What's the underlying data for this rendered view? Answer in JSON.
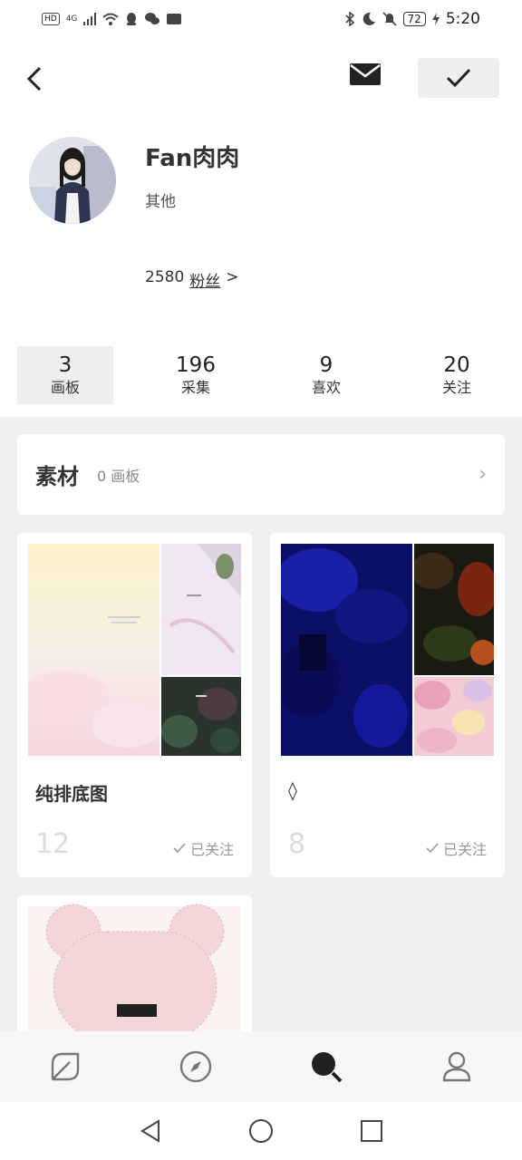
{
  "status_bar": {
    "left_badges": [
      "HD",
      "4G"
    ],
    "battery": "72",
    "time": "5:20"
  },
  "profile": {
    "username": "Fan肉肉",
    "subtitle": "其他",
    "followers_count": "2580",
    "followers_label": "粉丝",
    "followers_arrow": ">"
  },
  "stats": [
    {
      "num": "3",
      "label": "画板"
    },
    {
      "num": "196",
      "label": "采集"
    },
    {
      "num": "9",
      "label": "喜欢"
    },
    {
      "num": "20",
      "label": "关注"
    }
  ],
  "sucai": {
    "title": "素材",
    "sub": "0 画板",
    "arrow": "›"
  },
  "boards": [
    {
      "title": "纯排底图",
      "count": "12",
      "follow_label": "已关注"
    },
    {
      "title": "◊",
      "count": "8",
      "follow_label": "已关注"
    }
  ],
  "colors": {
    "accent": "#222222",
    "card_bg": "#ffffff",
    "page_bg": "#f0f0f0"
  },
  "icons": {
    "back": "chevron-left-icon",
    "mail": "mail-icon",
    "check": "check-icon",
    "nav": [
      "leaf-icon",
      "compass-icon",
      "search-icon",
      "profile-icon"
    ],
    "system": [
      "back-triangle-icon",
      "home-circle-icon",
      "recents-square-icon"
    ]
  }
}
